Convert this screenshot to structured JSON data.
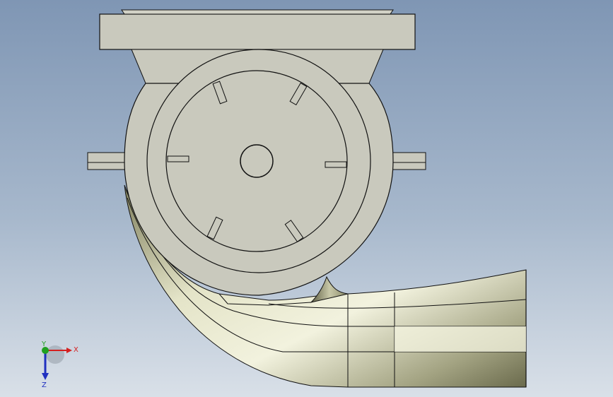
{
  "viewport": {
    "background_top": "#7f96b4",
    "background_bottom": "#d9e0e8",
    "part_face_color": "#c9c9bd",
    "part_edge_color": "#111111",
    "pipe_highlight_color": "#f4f4de",
    "pipe_shadow_color": "#6f6f52"
  },
  "triad": {
    "x_label": "X",
    "y_label": "Y",
    "z_label": "Z",
    "x_color": "#d42020",
    "y_color": "#20a020",
    "z_color": "#2030c0"
  }
}
